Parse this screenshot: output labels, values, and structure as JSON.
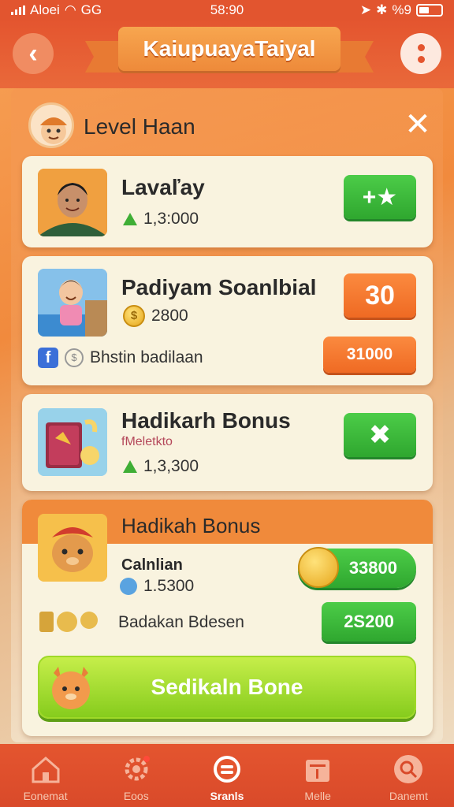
{
  "status_bar": {
    "carrier": "Aloei",
    "network": "GG",
    "time": "58:90",
    "battery": "%9"
  },
  "header": {
    "title": "KaiupuayaTaiyal"
  },
  "panel": {
    "title": "Level Haan"
  },
  "cards": [
    {
      "name": "Lavaľay",
      "value": "1,3:000",
      "button_label": "+★"
    },
    {
      "name": "Padiyam Soanlbial",
      "value": "2800",
      "badge": "30",
      "footer_label": "Bhstin badilaan",
      "footer_button": "31000"
    },
    {
      "name": "Hadikarh Bonus",
      "caption": "fMeletkto",
      "value": "1,3,300"
    },
    {
      "header": "Hadikah Bonus",
      "name": "Calnlian",
      "value": "1.5300",
      "coin_button": "33800",
      "row_label": "Badakan Bdesen",
      "row_button": "2S200",
      "big_button": "Sedikaln Bone"
    }
  ],
  "nav": [
    {
      "label": "Eonemat",
      "icon": "home-icon"
    },
    {
      "label": "Eoos",
      "icon": "settings-gear-icon"
    },
    {
      "label": "Sranls",
      "icon": "stats-icon"
    },
    {
      "label": "Melle",
      "icon": "shop-icon"
    },
    {
      "label": "Danemt",
      "icon": "search-icon"
    }
  ],
  "colors": {
    "accent": "#e4552f",
    "green": "#3fae35",
    "orange": "#ef6a23",
    "card": "#f9f3df"
  }
}
